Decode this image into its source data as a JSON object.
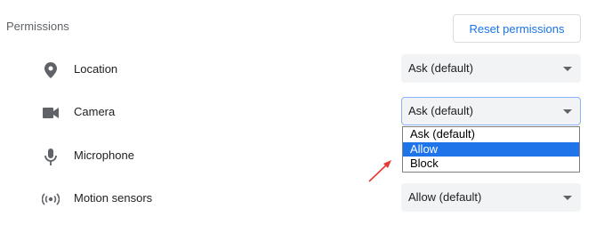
{
  "section": {
    "title": "Permissions"
  },
  "reset_button": {
    "label": "Reset permissions"
  },
  "permissions": [
    {
      "label": "Location",
      "icon": "location-pin-icon",
      "value": "Ask (default)"
    },
    {
      "label": "Camera",
      "icon": "videocam-icon",
      "value": "Ask (default)"
    },
    {
      "label": "Microphone",
      "icon": "microphone-icon",
      "value": ""
    },
    {
      "label": "Motion sensors",
      "icon": "motion-sensors-icon",
      "value": "Allow (default)"
    }
  ],
  "camera_dropdown": {
    "options": [
      "Ask (default)",
      "Allow",
      "Block"
    ],
    "highlighted": "Allow"
  },
  "colors": {
    "accent": "#1a73e8",
    "highlight": "#1e74e8",
    "annotation_arrow": "#e53935"
  }
}
